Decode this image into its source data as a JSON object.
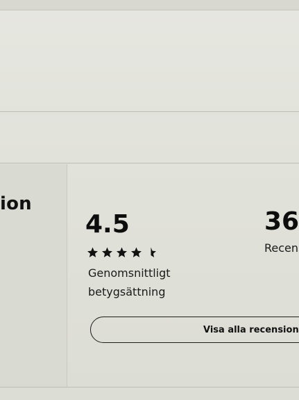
{
  "section": {
    "left_heading": "ion"
  },
  "rating": {
    "average": "4.5",
    "stars_filled": 4.5,
    "stars_max": 5,
    "caption_line1": "Genomsnittligt",
    "caption_line2": "betygsättning"
  },
  "reviews": {
    "count": "36",
    "label": "Recen",
    "all_button_label": "Visa alla recensioner"
  },
  "colors": {
    "text": "#111111",
    "background": "#e2e3db"
  },
  "icons": {
    "star": "star-icon",
    "half_star": "star-half-icon"
  }
}
